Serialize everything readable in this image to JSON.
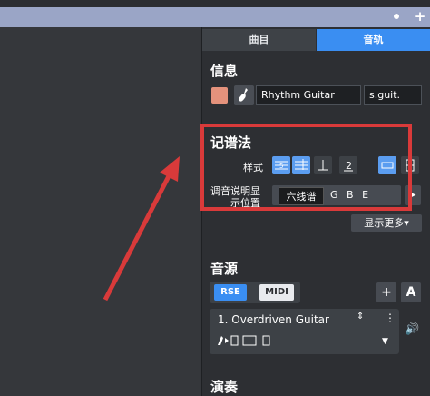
{
  "tabs": {
    "score_label": "曲目",
    "track_label": "音轨"
  },
  "info": {
    "title": "信息",
    "track_name": "Rhythm Guitar",
    "short_name": "s.guit."
  },
  "notation": {
    "title": "记谱法",
    "style_label": "样式",
    "tuning_label_line1": "调音说明显",
    "tuning_label_line2": "示位置",
    "tuning_value": "G B E",
    "tooltip": "六线谱",
    "more_label": "显示更多▾"
  },
  "sound": {
    "title": "音源",
    "rse_label": "RSE",
    "midi_label": "MIDI",
    "add_label": "+",
    "auto_label": "A",
    "sound_name": "1. Overdriven Guitar"
  },
  "play": {
    "title": "演奏"
  },
  "colors": {
    "accent": "#3a8ef2",
    "highlight": "#d93a3a",
    "track_color": "#e4927c"
  }
}
